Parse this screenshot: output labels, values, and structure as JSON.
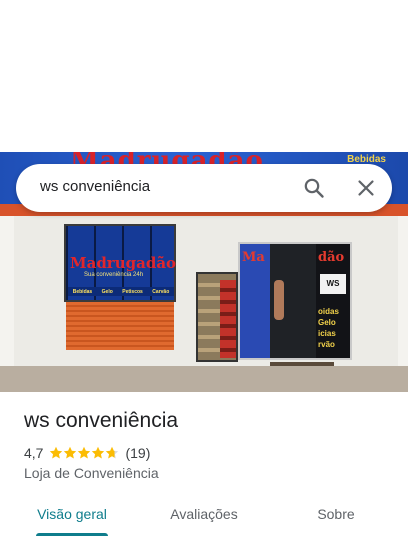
{
  "search": {
    "query": "ws conveniência"
  },
  "photo": {
    "banner_text": "Madrugadão",
    "banner_right": "Bebidas",
    "window_text": "Madrugadão",
    "window_sub": "Sua conveniência 24h",
    "window_tags": [
      "Bebidas",
      "Gelo",
      "Petiscos",
      "Carvão"
    ],
    "door_left": "Ma",
    "door_right": "dão",
    "door_ws": "WS",
    "door_items": [
      "oidas",
      "Gelo",
      "icias",
      "rvão"
    ]
  },
  "place": {
    "name": "ws conveniência",
    "rating": "4,7",
    "stars": 4.7,
    "review_count": "(19)",
    "category": "Loja de Conveniência"
  },
  "tabs": [
    {
      "label": "Visão geral",
      "active": true
    },
    {
      "label": "Avaliações",
      "active": false
    },
    {
      "label": "Sobre",
      "active": false
    }
  ],
  "colors": {
    "accent": "#0f7d8c",
    "star": "#fbbc04"
  }
}
